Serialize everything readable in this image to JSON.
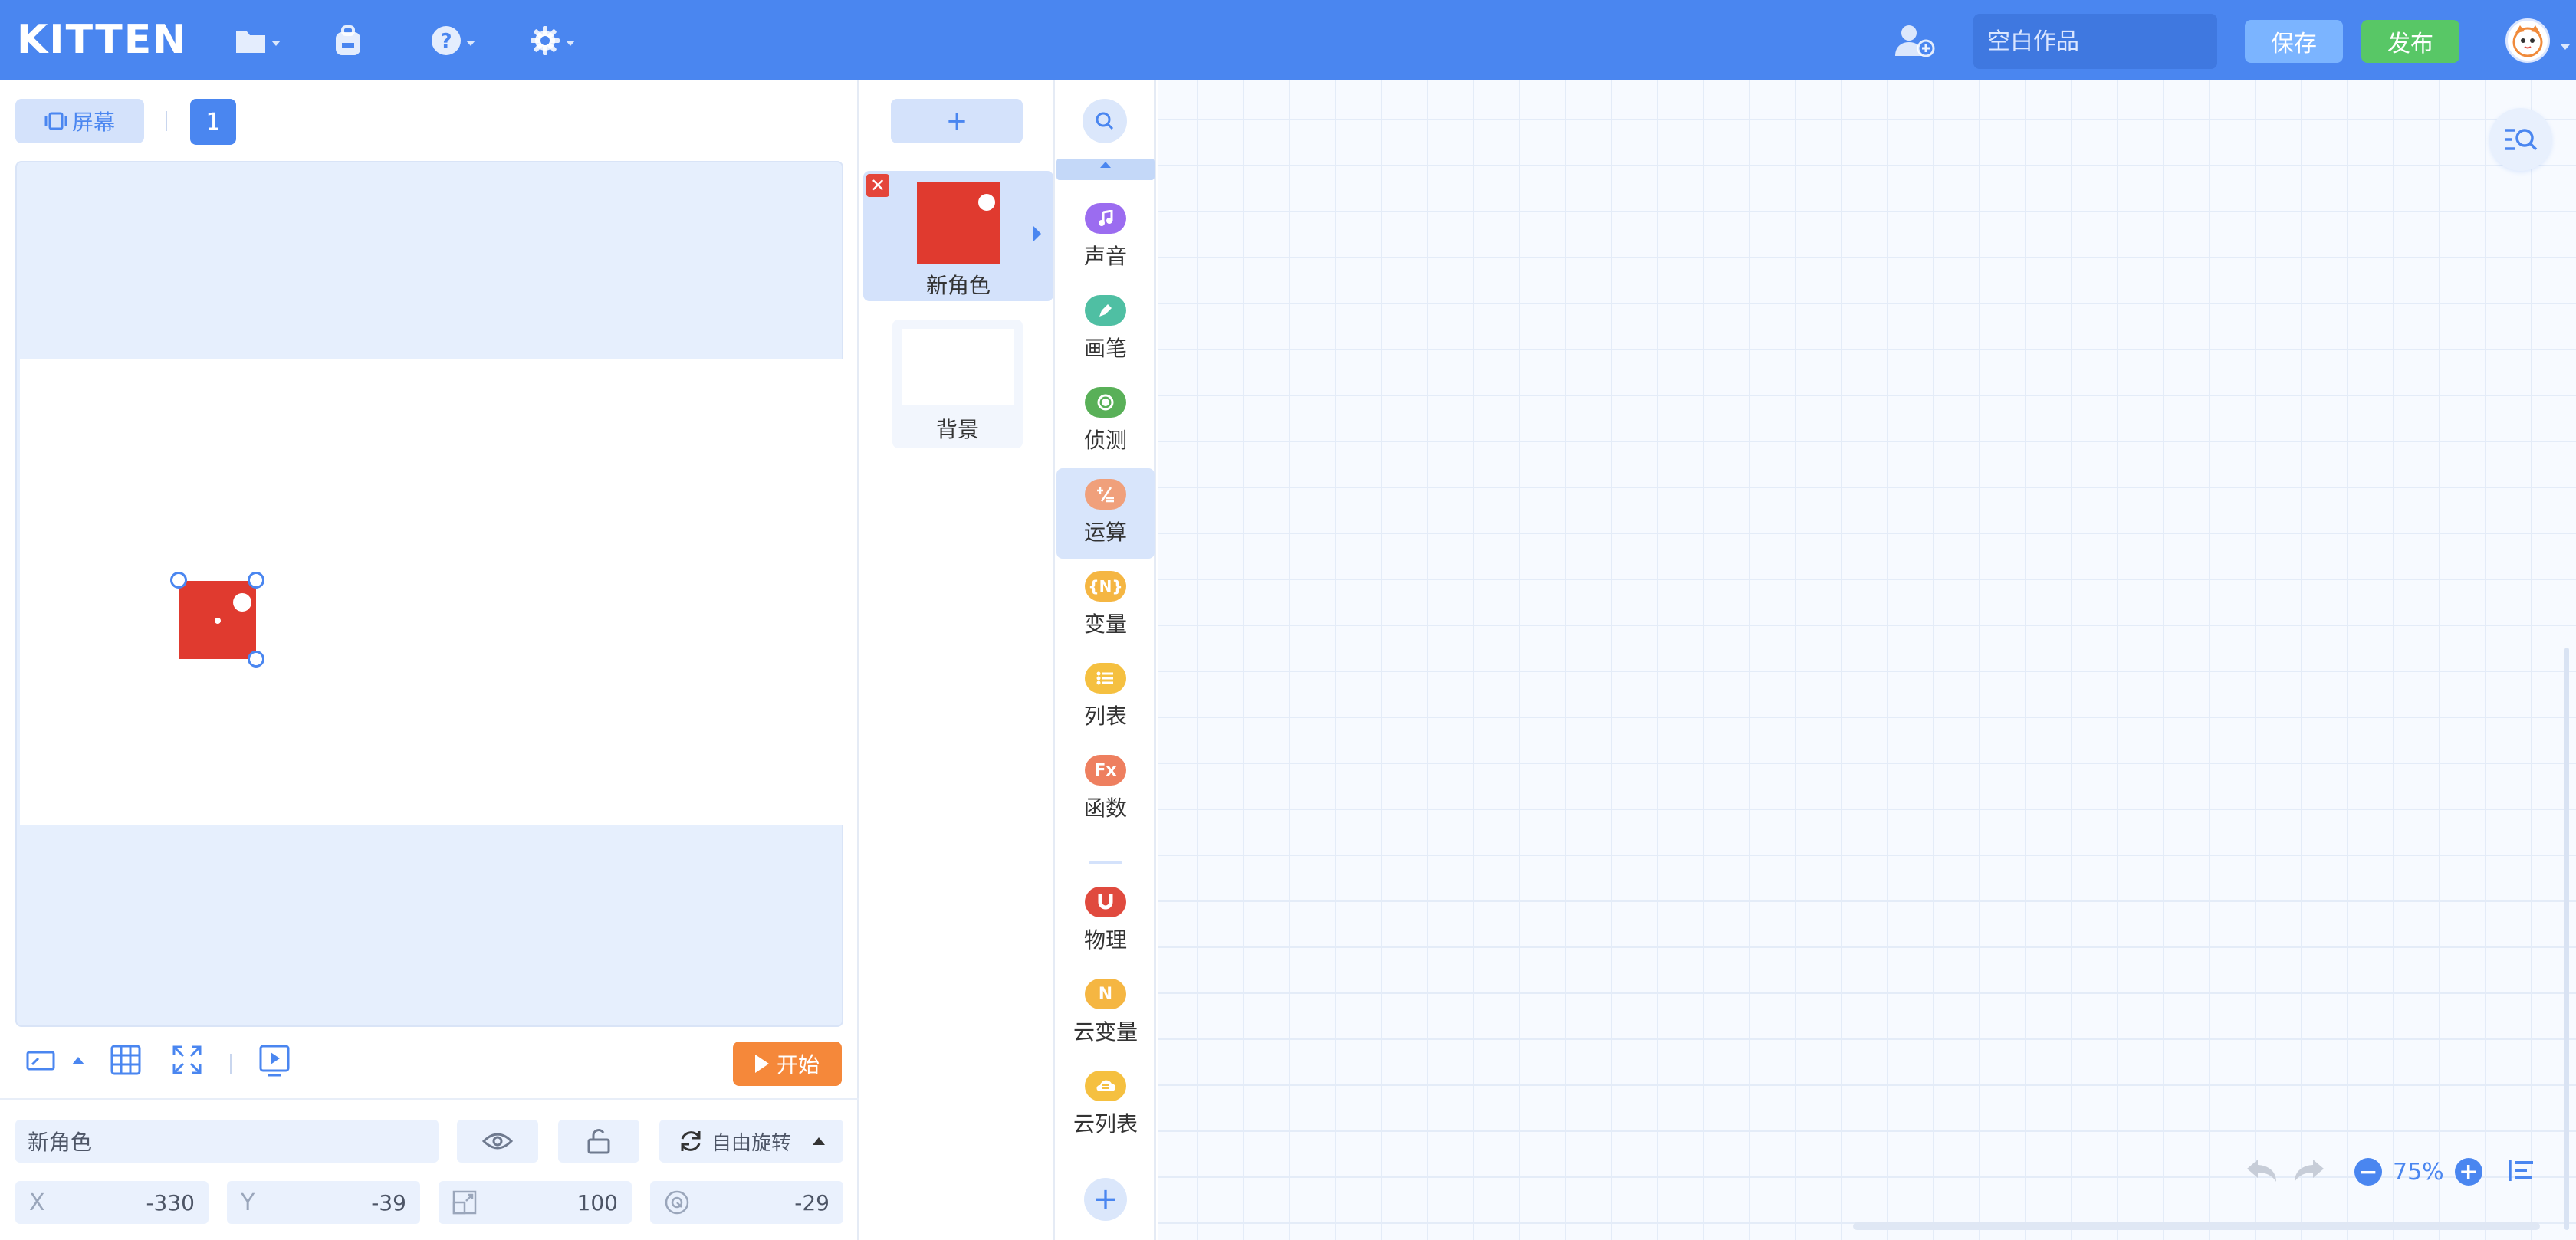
{
  "app": {
    "logo": "KITTEN",
    "title_placeholder": "空白作品",
    "save_label": "保存",
    "publish_label": "发布"
  },
  "stage_panel": {
    "screen_label": "屏幕",
    "page_number": "1",
    "start_label": "开始"
  },
  "sprite_props": {
    "name": "新角色",
    "rotation_mode": "自由旋转",
    "x_label": "X",
    "x": "-330",
    "y_label": "Y",
    "y": "-39",
    "size": "100",
    "direction": "-29"
  },
  "sprite_list": {
    "add_label": "+",
    "sprites": [
      {
        "name": "新角色"
      }
    ],
    "background_label": "背景"
  },
  "categories": [
    {
      "label": "声音",
      "color": "#9b6cf0",
      "icon": "music-icon"
    },
    {
      "label": "画笔",
      "color": "#4fbfa3",
      "icon": "pen-icon"
    },
    {
      "label": "侦测",
      "color": "#59b058",
      "icon": "sensing-icon"
    },
    {
      "label": "运算",
      "color": "#f0a07b",
      "icon": "operator-icon",
      "active": true
    },
    {
      "label": "变量",
      "color": "#f5b642",
      "icon": "variable-icon",
      "glyph": "{N}"
    },
    {
      "label": "列表",
      "color": "#f5c040",
      "icon": "list-icon"
    },
    {
      "label": "函数",
      "color": "#ee7f5f",
      "icon": "function-icon",
      "glyph": "Fx"
    },
    {
      "label": "物理",
      "color": "#e04a3e",
      "icon": "physics-icon"
    },
    {
      "label": "云变量",
      "color": "#f5b642",
      "icon": "cloud-variable-icon",
      "glyph": "N"
    },
    {
      "label": "云列表",
      "color": "#f5c040",
      "icon": "cloud-list-icon"
    }
  ],
  "workspace": {
    "zoom": "75%"
  },
  "colors": {
    "accent": "#4a86f0",
    "start": "#f5883a",
    "publish": "#58c766",
    "sprite": "#e03a2f"
  }
}
